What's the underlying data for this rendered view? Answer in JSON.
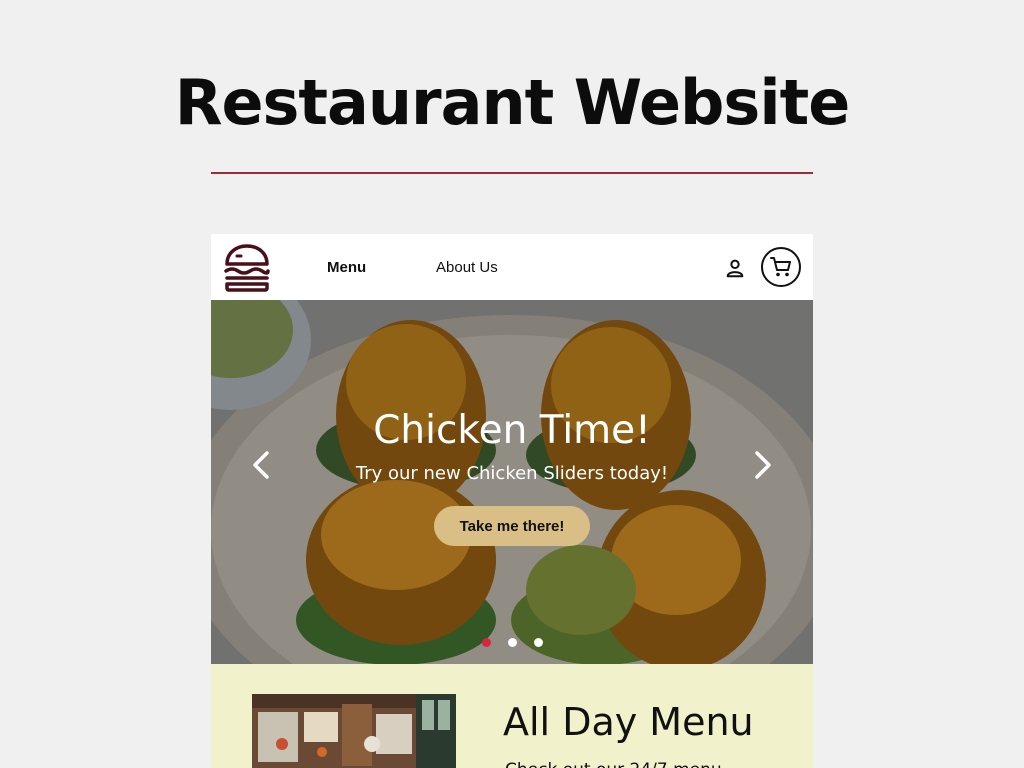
{
  "page": {
    "title": "Restaurant Website",
    "accent_color": "#a3283a"
  },
  "navbar": {
    "logo_icon": "burger-logo-icon",
    "links": [
      {
        "label": "Menu",
        "active": true
      },
      {
        "label": "About Us",
        "active": false
      }
    ],
    "account_icon": "user-icon",
    "cart_icon": "shopping-cart-icon"
  },
  "hero": {
    "heading": "Chicken Time!",
    "subheading": "Try our new Chicken Sliders today!",
    "cta_label": "Take me there!",
    "cta_color": "#d9bf86",
    "prev_icon": "chevron-left-icon",
    "next_icon": "chevron-right-icon",
    "slides_total": 3,
    "active_slide": 1,
    "active_dot_color": "#d8263f"
  },
  "menu_section": {
    "heading": "All Day Menu",
    "hours_text": "Check out our 24/7 menu",
    "background": "#f1f1cc"
  }
}
